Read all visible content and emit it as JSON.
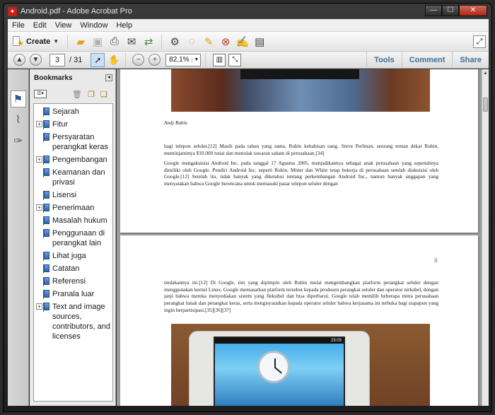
{
  "window": {
    "title": "Android.pdf - Adobe Acrobat Pro",
    "controls": {
      "minimize": "—",
      "maximize": "☐",
      "close": "✕"
    }
  },
  "menu": [
    "File",
    "Edit",
    "View",
    "Window",
    "Help"
  ],
  "toolbar": {
    "create_label": "Create",
    "icons": [
      "open-folder-icon",
      "save-icon",
      "print-icon",
      "email-icon",
      "share-icon",
      "settings-icon",
      "comment-icon",
      "sticky-note-icon",
      "stamp-icon",
      "pen-icon",
      "form-icon"
    ],
    "expand": "⤢"
  },
  "nav": {
    "current_page": "3",
    "page_total": "/ 31",
    "zoom": "82,1%",
    "links": {
      "tools": "Tools",
      "comment": "Comment",
      "share": "Share"
    }
  },
  "bookmarks": {
    "title": "Bookmarks",
    "items": [
      {
        "label": "Sejarah",
        "expandable": false
      },
      {
        "label": "Fitur",
        "expandable": true
      },
      {
        "label": "Persyaratan perangkat keras",
        "expandable": false
      },
      {
        "label": "Pengembangan",
        "expandable": true
      },
      {
        "label": "Keamanan dan privasi",
        "expandable": false
      },
      {
        "label": "Lisensi",
        "expandable": false
      },
      {
        "label": "Penerimaan",
        "expandable": true
      },
      {
        "label": "Masalah hukum",
        "expandable": false
      },
      {
        "label": "Penggunaan di perangkat lain",
        "expandable": false
      },
      {
        "label": "Lihat juga",
        "expandable": false
      },
      {
        "label": "Catatan",
        "expandable": false
      },
      {
        "label": "Referensi",
        "expandable": false
      },
      {
        "label": "Pranala luar",
        "expandable": false
      },
      {
        "label": "Text and image sources, contributors, and licenses",
        "expandable": true
      }
    ]
  },
  "document": {
    "page1": {
      "caption": "Andy Rubin",
      "para1": "bagi telepon seluler.[12] Masih pada tahun yang sama, Rubin kehabisan uang. Steve Perlman, seorang teman dekat Rubin, meminjaminya $10.000 tunai dan menolak tawaran saham di perusahaan.[34]",
      "para2": "Google mengakuisisi Android Inc. pada tanggal 17 Agustus 2005, menjadikannya sebagai anak perusahaan yang sepenuhnya dimiliki oleh Google. Pendiri Android Inc. seperti Rubin, Miner dan White tetap bekerja di perusahaan setelah diakuisisi oleh Google.[12] Setelah itu, tidak banyak yang diketahui tentang perkembangan Android Inc., namun banyak anggapan yang menyatakan bahwa Google berencana untuk memasuki pasar telepon seluler dengan"
    },
    "page2": {
      "page_number": "3",
      "para1": "tindakannya ini.[12] Di Google, tim yang dipimpin oleh Rubin mulai mengembangkan platform perangkat seluler dengan menggunakan kernel Linux. Google memasarkan platform tersebut kepada produsen perangkat seluler dan operator nirkabel, dengan janji bahwa mereka menyediakan sistem yang fleksibel dan bisa diperbarui. Google telah memilih beberapa mitra perusahaan perangkat lunak dan perangkat keras, serta mengisyaratkan kepada operator seluler bahwa kerjasama ini terbuka bagi siapapun yang ingin berpartisipasi.[35][36][37]",
      "phone_status": "23:03"
    }
  }
}
